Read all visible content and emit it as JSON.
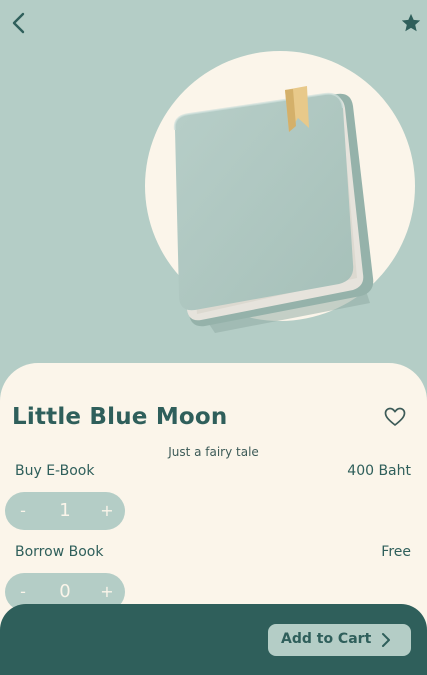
{
  "header": {
    "back_icon": "chevron-left-icon",
    "favorite_icon": "star-icon"
  },
  "book": {
    "title": "Little Blue Moon",
    "subtitle": "Just a fairy tale",
    "like_icon": "heart-outline-icon"
  },
  "ebook": {
    "label": "Buy E-Book",
    "price": "400 Baht",
    "minus": "-",
    "quantity": "1",
    "plus": "+"
  },
  "borrow": {
    "label": "Borrow Book",
    "price": "Free",
    "minus": "-",
    "quantity": "0",
    "plus": "+"
  },
  "footer": {
    "cart_label": "Add to Cart",
    "cart_icon": "chevron-right-icon"
  },
  "colors": {
    "sage": "#b4cdc6",
    "cream": "#fbf5ea",
    "teal_dark": "#2f5f5b"
  }
}
